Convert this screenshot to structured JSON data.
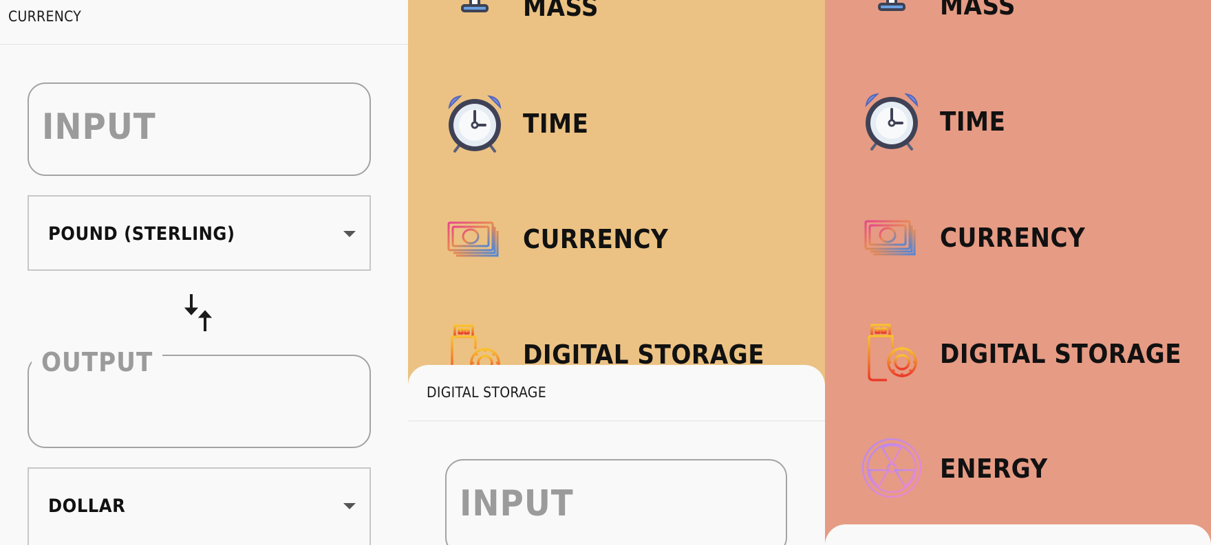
{
  "currency_panel": {
    "title": "CURRENCY",
    "input_placeholder": "INPUT",
    "from_unit": "POUND (STERLING)",
    "output_label": "OUTPUT",
    "to_unit": "DOLLAR"
  },
  "categories_mid": [
    {
      "label": "MASS",
      "icon": "scale-icon"
    },
    {
      "label": "TIME",
      "icon": "alarm-clock-icon"
    },
    {
      "label": "CURRENCY",
      "icon": "banknotes-icon"
    },
    {
      "label": "DIGITAL STORAGE",
      "icon": "usb-storage-icon"
    }
  ],
  "digital_storage_sheet": {
    "title": "DIGITAL STORAGE",
    "input_placeholder": "INPUT"
  },
  "categories_right": [
    {
      "label": "MASS",
      "icon": "scale-icon"
    },
    {
      "label": "TIME",
      "icon": "alarm-clock-icon"
    },
    {
      "label": "CURRENCY",
      "icon": "banknotes-icon"
    },
    {
      "label": "DIGITAL STORAGE",
      "icon": "usb-storage-icon"
    },
    {
      "label": "ENERGY",
      "icon": "radiation-icon"
    }
  ],
  "colors": {
    "panel_orange": "#ebc283",
    "panel_salmon": "#e69b84",
    "sheet": "#f9f9f9"
  }
}
